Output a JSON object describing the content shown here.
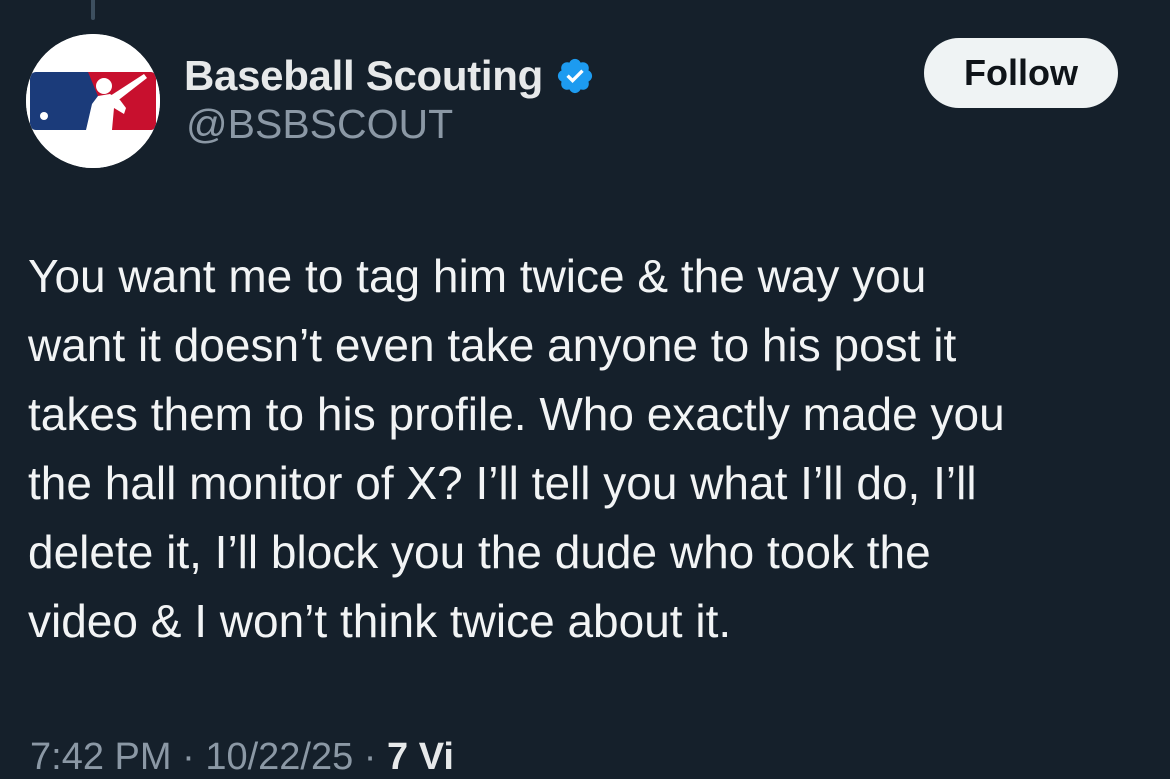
{
  "author": {
    "display_name": "Baseball Scouting",
    "handle": "@BSBSCOUT",
    "verified": true,
    "avatar": "mlb-logo"
  },
  "follow_button": {
    "label": "Follow"
  },
  "tweet": {
    "lines": [
      "You want me to tag him twice & the way you",
      "want it doesn’t even take anyone to his post it",
      "takes them to his profile. Who exactly made you",
      "the hall monitor of X? I’ll tell you what I’ll do, I’ll",
      "delete it, I’ll block you the dude who took the",
      "video & I won’t think twice about it."
    ]
  },
  "meta": {
    "time": "7:42 PM",
    "date": "10/22/25",
    "views": "7 Vi"
  },
  "colors": {
    "background": "#15202b",
    "verified_badge": "#1d9bf0",
    "logo_blue": "#1b3b7a",
    "logo_red": "#c8102e"
  }
}
